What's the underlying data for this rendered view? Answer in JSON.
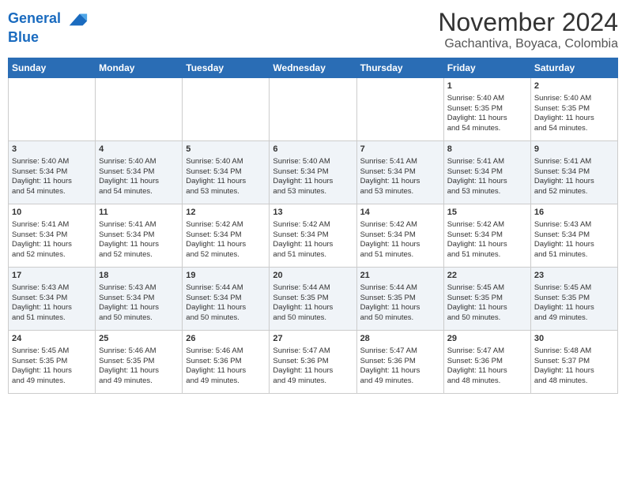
{
  "header": {
    "logo_line1": "General",
    "logo_line2": "Blue",
    "month": "November 2024",
    "location": "Gachantiva, Boyaca, Colombia"
  },
  "weekdays": [
    "Sunday",
    "Monday",
    "Tuesday",
    "Wednesday",
    "Thursday",
    "Friday",
    "Saturday"
  ],
  "weeks": [
    [
      {
        "day": "",
        "text": ""
      },
      {
        "day": "",
        "text": ""
      },
      {
        "day": "",
        "text": ""
      },
      {
        "day": "",
        "text": ""
      },
      {
        "day": "",
        "text": ""
      },
      {
        "day": "1",
        "text": "Sunrise: 5:40 AM\nSunset: 5:35 PM\nDaylight: 11 hours\nand 54 minutes."
      },
      {
        "day": "2",
        "text": "Sunrise: 5:40 AM\nSunset: 5:35 PM\nDaylight: 11 hours\nand 54 minutes."
      }
    ],
    [
      {
        "day": "3",
        "text": "Sunrise: 5:40 AM\nSunset: 5:34 PM\nDaylight: 11 hours\nand 54 minutes."
      },
      {
        "day": "4",
        "text": "Sunrise: 5:40 AM\nSunset: 5:34 PM\nDaylight: 11 hours\nand 54 minutes."
      },
      {
        "day": "5",
        "text": "Sunrise: 5:40 AM\nSunset: 5:34 PM\nDaylight: 11 hours\nand 53 minutes."
      },
      {
        "day": "6",
        "text": "Sunrise: 5:40 AM\nSunset: 5:34 PM\nDaylight: 11 hours\nand 53 minutes."
      },
      {
        "day": "7",
        "text": "Sunrise: 5:41 AM\nSunset: 5:34 PM\nDaylight: 11 hours\nand 53 minutes."
      },
      {
        "day": "8",
        "text": "Sunrise: 5:41 AM\nSunset: 5:34 PM\nDaylight: 11 hours\nand 53 minutes."
      },
      {
        "day": "9",
        "text": "Sunrise: 5:41 AM\nSunset: 5:34 PM\nDaylight: 11 hours\nand 52 minutes."
      }
    ],
    [
      {
        "day": "10",
        "text": "Sunrise: 5:41 AM\nSunset: 5:34 PM\nDaylight: 11 hours\nand 52 minutes."
      },
      {
        "day": "11",
        "text": "Sunrise: 5:41 AM\nSunset: 5:34 PM\nDaylight: 11 hours\nand 52 minutes."
      },
      {
        "day": "12",
        "text": "Sunrise: 5:42 AM\nSunset: 5:34 PM\nDaylight: 11 hours\nand 52 minutes."
      },
      {
        "day": "13",
        "text": "Sunrise: 5:42 AM\nSunset: 5:34 PM\nDaylight: 11 hours\nand 51 minutes."
      },
      {
        "day": "14",
        "text": "Sunrise: 5:42 AM\nSunset: 5:34 PM\nDaylight: 11 hours\nand 51 minutes."
      },
      {
        "day": "15",
        "text": "Sunrise: 5:42 AM\nSunset: 5:34 PM\nDaylight: 11 hours\nand 51 minutes."
      },
      {
        "day": "16",
        "text": "Sunrise: 5:43 AM\nSunset: 5:34 PM\nDaylight: 11 hours\nand 51 minutes."
      }
    ],
    [
      {
        "day": "17",
        "text": "Sunrise: 5:43 AM\nSunset: 5:34 PM\nDaylight: 11 hours\nand 51 minutes."
      },
      {
        "day": "18",
        "text": "Sunrise: 5:43 AM\nSunset: 5:34 PM\nDaylight: 11 hours\nand 50 minutes."
      },
      {
        "day": "19",
        "text": "Sunrise: 5:44 AM\nSunset: 5:34 PM\nDaylight: 11 hours\nand 50 minutes."
      },
      {
        "day": "20",
        "text": "Sunrise: 5:44 AM\nSunset: 5:35 PM\nDaylight: 11 hours\nand 50 minutes."
      },
      {
        "day": "21",
        "text": "Sunrise: 5:44 AM\nSunset: 5:35 PM\nDaylight: 11 hours\nand 50 minutes."
      },
      {
        "day": "22",
        "text": "Sunrise: 5:45 AM\nSunset: 5:35 PM\nDaylight: 11 hours\nand 50 minutes."
      },
      {
        "day": "23",
        "text": "Sunrise: 5:45 AM\nSunset: 5:35 PM\nDaylight: 11 hours\nand 49 minutes."
      }
    ],
    [
      {
        "day": "24",
        "text": "Sunrise: 5:45 AM\nSunset: 5:35 PM\nDaylight: 11 hours\nand 49 minutes."
      },
      {
        "day": "25",
        "text": "Sunrise: 5:46 AM\nSunset: 5:35 PM\nDaylight: 11 hours\nand 49 minutes."
      },
      {
        "day": "26",
        "text": "Sunrise: 5:46 AM\nSunset: 5:36 PM\nDaylight: 11 hours\nand 49 minutes."
      },
      {
        "day": "27",
        "text": "Sunrise: 5:47 AM\nSunset: 5:36 PM\nDaylight: 11 hours\nand 49 minutes."
      },
      {
        "day": "28",
        "text": "Sunrise: 5:47 AM\nSunset: 5:36 PM\nDaylight: 11 hours\nand 49 minutes."
      },
      {
        "day": "29",
        "text": "Sunrise: 5:47 AM\nSunset: 5:36 PM\nDaylight: 11 hours\nand 48 minutes."
      },
      {
        "day": "30",
        "text": "Sunrise: 5:48 AM\nSunset: 5:37 PM\nDaylight: 11 hours\nand 48 minutes."
      }
    ]
  ]
}
